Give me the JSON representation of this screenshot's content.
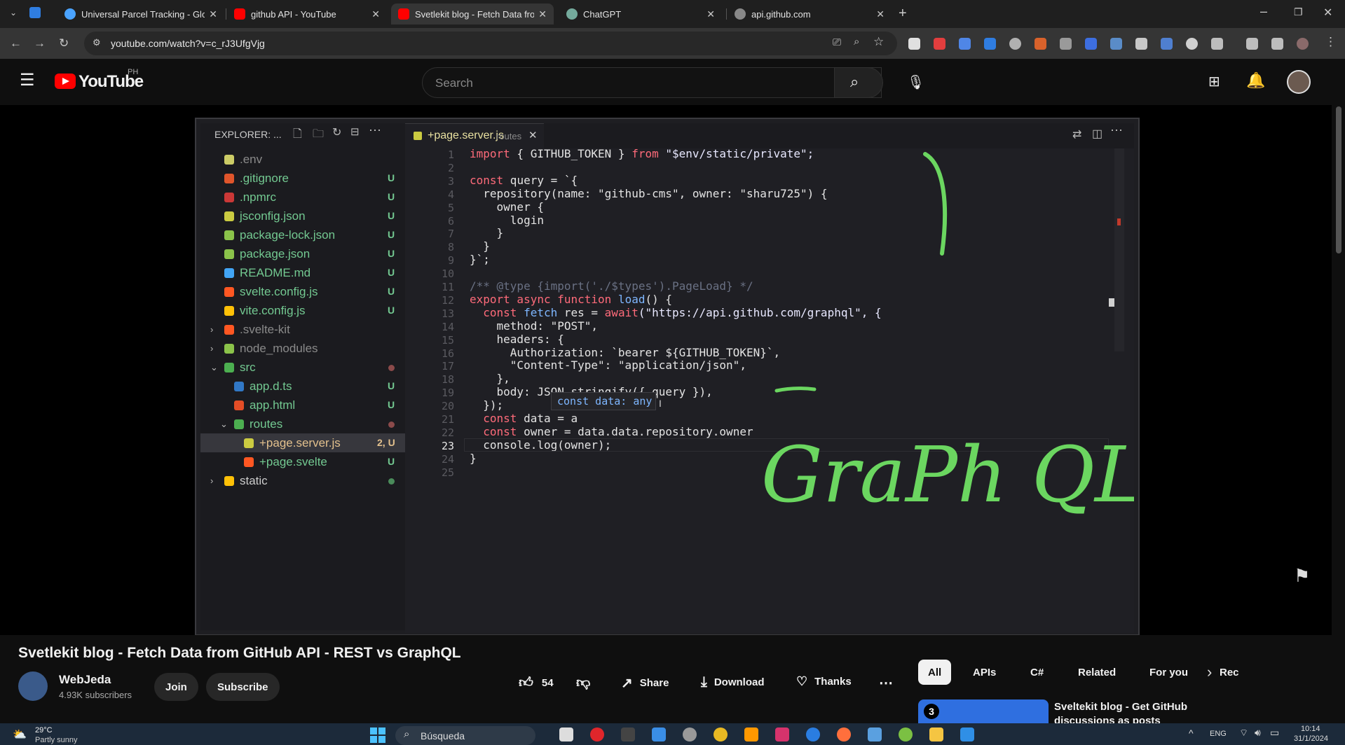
{
  "browser": {
    "tabs": [
      {
        "title": "Universal Parcel Tracking - Glob",
        "color": "#4aa3ff"
      },
      {
        "title": "github API - YouTube",
        "color": "#ff0000"
      },
      {
        "title": "Svetlekit blog - Fetch Data from",
        "color": "#ff0000"
      },
      {
        "title": "ChatGPT",
        "color": "#74aa9c"
      },
      {
        "title": "api.github.com",
        "color": "#888888"
      }
    ],
    "url": "youtube.com/watch?v=c_rJ3UfgVjg"
  },
  "youtube": {
    "logo_text": "YouTube",
    "region": "PH",
    "search_placeholder": "Search"
  },
  "vscode": {
    "explorer_title": "EXPLORER: ...",
    "tab_name": "+page.server.js",
    "tab_hint": "routes",
    "files": [
      {
        "name": ".env",
        "status": "",
        "indent": 0,
        "icon": "#cccc66",
        "dim": true
      },
      {
        "name": ".gitignore",
        "status": "U",
        "indent": 0,
        "icon": "#e0552b",
        "dim": false
      },
      {
        "name": ".npmrc",
        "status": "U",
        "indent": 0,
        "icon": "#cb3837",
        "dim": false
      },
      {
        "name": "jsconfig.json",
        "status": "U",
        "indent": 0,
        "icon": "#cbcb41",
        "dim": false
      },
      {
        "name": "package-lock.json",
        "status": "U",
        "indent": 0,
        "icon": "#8bc34a",
        "dim": false
      },
      {
        "name": "package.json",
        "status": "U",
        "indent": 0,
        "icon": "#8bc34a",
        "dim": false
      },
      {
        "name": "README.md",
        "status": "U",
        "indent": 0,
        "icon": "#42a5f5",
        "dim": false
      },
      {
        "name": "svelte.config.js",
        "status": "U",
        "indent": 0,
        "icon": "#ff5722",
        "dim": false
      },
      {
        "name": "vite.config.js",
        "status": "U",
        "indent": 0,
        "icon": "#ffc107",
        "dim": false
      },
      {
        "name": ".svelte-kit",
        "status": "",
        "indent": 0,
        "icon": "#ff5722",
        "dim": true,
        "folder": true
      },
      {
        "name": "node_modules",
        "status": "",
        "indent": 0,
        "icon": "#8bc34a",
        "dim": true,
        "folder": true
      },
      {
        "name": "src",
        "status": "dot",
        "indent": 0,
        "icon": "#4caf50",
        "dim": false,
        "folder": true,
        "open": true
      },
      {
        "name": "app.d.ts",
        "status": "U",
        "indent": 1,
        "icon": "#3178c6",
        "dim": false
      },
      {
        "name": "app.html",
        "status": "U",
        "indent": 1,
        "icon": "#e44d26",
        "dim": false
      },
      {
        "name": "routes",
        "status": "dot",
        "indent": 1,
        "icon": "#4caf50",
        "dim": false,
        "folder": true,
        "open": true
      },
      {
        "name": "+page.server.js",
        "status": "2, U",
        "indent": 2,
        "icon": "#cbcb41",
        "dim": false,
        "selected": true
      },
      {
        "name": "+page.svelte",
        "status": "U",
        "indent": 2,
        "icon": "#ff5722",
        "dim": false
      },
      {
        "name": "static",
        "status": "dotg",
        "indent": 0,
        "icon": "#ffc107",
        "dim": false,
        "folder": true
      }
    ],
    "line_numbers": [
      "1",
      "2",
      "3",
      "4",
      "5",
      "6",
      "7",
      "8",
      "9",
      "10",
      "11",
      "12",
      "13",
      "14",
      "15",
      "16",
      "17",
      "18",
      "19",
      "20",
      "21",
      "22",
      "23",
      "24",
      "25"
    ],
    "code": [
      {
        "k": "import",
        "r": " { GITHUB_TOKEN } ",
        "k2": "from",
        "s": " \"$env/static/private\";"
      },
      {
        "t": ""
      },
      {
        "k": "const",
        "r": " query = `{"
      },
      {
        "t": "  repository(name: \"github-cms\", owner: \"sharu725\") {"
      },
      {
        "t": "    owner {"
      },
      {
        "t": "      login"
      },
      {
        "t": "    }"
      },
      {
        "t": "  }"
      },
      {
        "t": "}`;"
      },
      {
        "t": ""
      },
      {
        "c": "/** @type {import('./$types').PageLoad} */"
      },
      {
        "k": "export async function",
        "f": " load",
        "r": "() {"
      },
      {
        "k": "  const",
        "r": " res = ",
        "k2": "await",
        "f": " fetch",
        "s": "(\"https://api.github.com/graphql\", {"
      },
      {
        "t": "    method: \"POST\","
      },
      {
        "t": "    headers: {"
      },
      {
        "t": "      Authorization: `bearer ${GITHUB_TOKEN}`,"
      },
      {
        "t": "      \"Content-Type\": \"application/json\","
      },
      {
        "t": "    },"
      },
      {
        "t": "    body: JSON.stringify({ query }),"
      },
      {
        "t": "  });"
      },
      {
        "k": "  const",
        "r": " data = a"
      },
      {
        "k": "  const",
        "r": " owner = data.data.repository.owner"
      },
      {
        "t": "  console.log(owner);"
      },
      {
        "t": "}"
      },
      {
        "t": ""
      }
    ],
    "hover_tooltip": "const data: any",
    "handwriting": "GraPh QL"
  },
  "video": {
    "title": "Svetlekit blog - Fetch Data from GitHub API - REST vs GraphQL",
    "channel": "WebJeda",
    "subscribers": "4.93K subscribers",
    "join_label": "Join",
    "subscribe_label": "Subscribe",
    "likes": "54",
    "share_label": "Share",
    "download_label": "Download",
    "thanks_label": "Thanks"
  },
  "chips": [
    "All",
    "APIs",
    "C#",
    "Related",
    "For you",
    "Rec"
  ],
  "recommendation": {
    "badge": "3",
    "title": "Sveltekit blog - Get GitHub",
    "title2": "discussions as posts"
  },
  "taskbar": {
    "weather_temp": "29°C",
    "weather_desc": "Partly sunny",
    "search_label": "Búsqueda",
    "lang": "ENG",
    "time": "10:14",
    "date": "31/1/2024"
  }
}
